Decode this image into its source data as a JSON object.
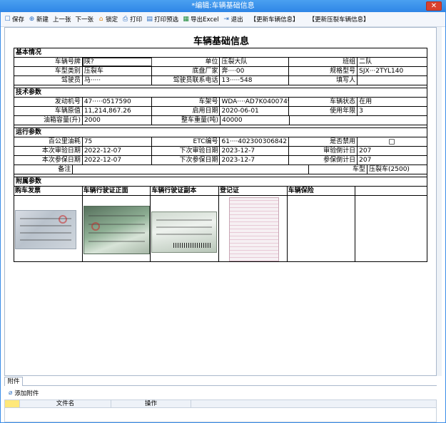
{
  "window": {
    "title": "*编辑:车辆基础信息",
    "close_label": "✕"
  },
  "toolbar": {
    "buttons": [
      {
        "icon": "save-icon",
        "glyph": "☐",
        "label": "保存"
      },
      {
        "icon": "add-icon",
        "glyph": "⊕",
        "label": "新建"
      },
      {
        "icon": "none",
        "glyph": "",
        "label": "上一张"
      },
      {
        "icon": "none",
        "glyph": "",
        "label": "下一张"
      },
      {
        "icon": "lock-icon",
        "glyph": "⌂",
        "label": "锁定"
      },
      {
        "icon": "print-icon",
        "glyph": "⎙",
        "label": "打印"
      },
      {
        "icon": "print-preview-icon",
        "glyph": "▤",
        "label": "打印预选"
      },
      {
        "icon": "excel-icon",
        "glyph": "▦",
        "label": "导出Excel"
      },
      {
        "icon": "exit-icon",
        "glyph": "⇥",
        "label": "退出"
      }
    ],
    "extra_buttons": [
      "【更新车辆信息】",
      "【更新压裂车辆信息】"
    ]
  },
  "form": {
    "title": "车辆基础信息",
    "basic": {
      "header": "基本情况",
      "rows": [
        [
          [
            "车辆号牌",
            "陕?"
          ],
          [
            "单位",
            "压裂大队"
          ],
          [
            "班组",
            "二队"
          ]
        ],
        [
          [
            "车型类别",
            "压裂车"
          ],
          [
            "底盘厂家",
            "奔····00"
          ],
          [
            "规格型号",
            "SJX···2TYL140"
          ]
        ],
        [
          [
            "驾驶员",
            "马·····"
          ],
          [
            "驾驶员联系电话",
            "13·····548"
          ],
          [
            "填写人",
            ""
          ]
        ]
      ]
    },
    "tech": {
      "header": "技术参数",
      "rows": [
        [
          [
            "发动机号",
            "47·····0517590"
          ],
          [
            "车架号",
            "WDA····AD7K0400749"
          ],
          [
            "车辆状态",
            "在用"
          ]
        ],
        [
          [
            "车辆原值",
            "11,214,867.26"
          ],
          [
            "启用日期",
            "2020-06-01"
          ],
          [
            "使用年限",
            "3"
          ]
        ],
        [
          [
            "油箱容量(升)",
            "2000"
          ],
          [
            "整车重量(吨)",
            "40000"
          ]
        ]
      ]
    },
    "run": {
      "header": "运行参数",
      "rows": [
        [
          [
            "百公里油耗",
            "75"
          ],
          [
            "ETC编号",
            "61····402300306842"
          ],
          [
            "是否禁用",
            ""
          ]
        ],
        [
          [
            "本次审验日期",
            "2022-12-07"
          ],
          [
            "下次审验日期",
            "2023-12-7"
          ],
          [
            "审验倒计日",
            "207"
          ]
        ],
        [
          [
            "本次参保日期",
            "2022-12-07"
          ],
          [
            "下次参保日期",
            "2023-12-7"
          ],
          [
            "参保倒计日",
            "207"
          ]
        ],
        [
          [
            "备注",
            ""
          ],
          [
            "车型",
            "压裂车(2500)"
          ]
        ]
      ]
    },
    "attachments": {
      "header": "附属参数",
      "columns": [
        "购车发票",
        "车辆行驶证正面",
        "车辆行驶证副本",
        "登记证",
        "车辆保险",
        ""
      ]
    }
  },
  "attach_panel": {
    "tab_label": "附件",
    "add_label": "添加附件",
    "grid_columns": [
      "文件名",
      "操作"
    ]
  },
  "colors": {
    "titlebar": "#2f86e6",
    "close": "#d9412e",
    "selected_col": "#ffe87a"
  }
}
